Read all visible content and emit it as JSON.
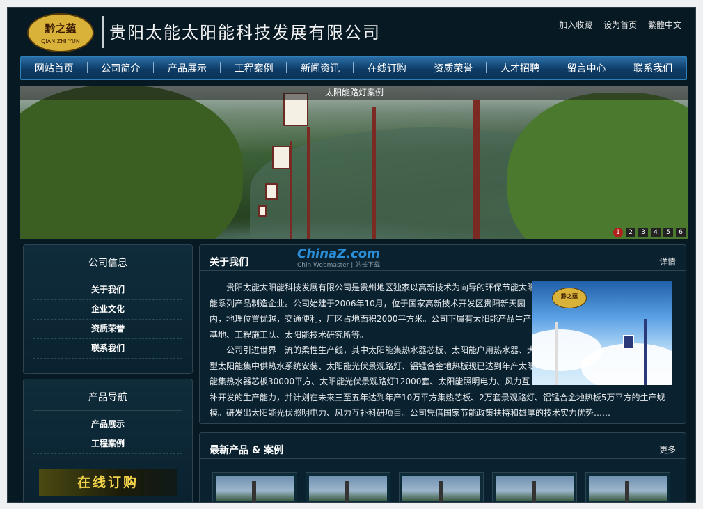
{
  "header": {
    "logo_cn": "黔之蕴",
    "logo_en": "QIAN ZHI YUN",
    "site_title": "贵阳太能太阳能科技发展有限公司",
    "top_links": [
      "加入收藏",
      "设为首页",
      "繁體中文"
    ]
  },
  "nav": [
    "网站首页",
    "公司简介",
    "产品展示",
    "工程案例",
    "新闻资讯",
    "在线订购",
    "资质荣誉",
    "人才招聘",
    "留言中心",
    "联系我们"
  ],
  "banner": {
    "caption": "太阳能路灯案例",
    "pages": [
      "1",
      "2",
      "3",
      "4",
      "5",
      "6"
    ],
    "active_page": "1"
  },
  "sidebar": {
    "company_info": {
      "title": "公司信息",
      "items": [
        "关于我们",
        "企业文化",
        "资质荣誉",
        "联系我们"
      ]
    },
    "product_nav": {
      "title": "产品导航",
      "items": [
        "产品展示",
        "工程案例"
      ],
      "order_button": "在线订购"
    }
  },
  "about": {
    "title": "关于我们",
    "more": "详情",
    "watermark": "ChinaZ.com",
    "watermark_sub": "Chin Webmaster | 站长下载",
    "image_badge": "黔之蕴",
    "paragraphs": [
      "贵阳太能太阳能科技发展有限公司是贵州地区独家以高新技术为向导的环保节能太阳能系列产品制造企业。公司始建于2006年10月，位于国家高新技术开发区贵阳新天园内，地理位置优越，交通便利，厂区占地面积2000平方米。公司下属有太阳能产品生产基地、工程施工队、太阳能技术研究所等。",
      "公司引进世界一流的柔性生产线，其中太阳能集热水器芯板、太阳能户用热水器、大型太阳能集中供热水系统安装、太阳能光伏景观路灯、铝锰合金地热板现已达到年产太阳能集热水器芯板30000平方、太阳能光伏景观路灯12000套、太阳能照明电力、风力互补开发的生产能力，并计划在未来三至五年达到年产10万平方集热芯板、2万套景观路灯、铝锰合金地热板5万平方的生产规模。研发出太阳能光伏照明电力、风力互补科研项目。公司凭借国家节能政策扶持和雄厚的技术实力优势……"
    ]
  },
  "latest": {
    "title": "最新产品 & 案例",
    "more": "更多",
    "thumb_count": 5
  }
}
